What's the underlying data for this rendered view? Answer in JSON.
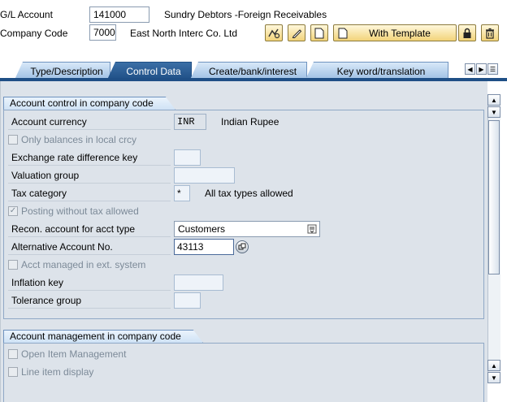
{
  "header": {
    "gl_account_label": "G/L Account",
    "gl_account_value": "141000",
    "gl_account_desc": "Sundry Debtors -Foreign Receivables",
    "company_code_label": "Company Code",
    "company_code_value": "7000",
    "company_name": "East North Interc Co. Ltd",
    "with_template_label": "With Template"
  },
  "toolbar_icons": [
    "change-display-icon",
    "edit-pencil-icon",
    "create-document-icon",
    "template-document-icon",
    "lock-icon",
    "trash-icon"
  ],
  "tabs": [
    {
      "label": "Type/Description",
      "active": false
    },
    {
      "label": "Control Data",
      "active": true
    },
    {
      "label": "Create/bank/interest",
      "active": false
    },
    {
      "label": "Key word/translation",
      "active": false
    }
  ],
  "account_control": {
    "title": "Account control in company code",
    "account_currency_label": "Account currency",
    "account_currency_value": "INR",
    "account_currency_desc": "Indian Rupee",
    "only_balances_label": "Only balances in local crcy",
    "only_balances_checked": false,
    "exchange_rate_label": "Exchange rate difference key",
    "exchange_rate_value": "",
    "valuation_group_label": "Valuation group",
    "valuation_group_value": "",
    "tax_category_label": "Tax category",
    "tax_category_value": "*",
    "tax_category_desc": "All tax types allowed",
    "posting_without_tax_label": "Posting without tax allowed",
    "posting_without_tax_checked": true,
    "recon_account_label": "Recon. account for acct type",
    "recon_account_value": "Customers",
    "alt_account_label": "Alternative Account No.",
    "alt_account_value": "43113",
    "acct_managed_ext_label": "Acct managed in ext. system",
    "acct_managed_ext_checked": false,
    "inflation_key_label": "Inflation key",
    "inflation_key_value": "",
    "tolerance_group_label": "Tolerance group",
    "tolerance_group_value": ""
  },
  "account_management": {
    "title": "Account management in company code",
    "open_item_label": "Open Item Management",
    "open_item_checked": false,
    "line_item_label": "Line item display",
    "line_item_checked": false
  },
  "colors": {
    "active_tab": "#1f4f86",
    "tab": "#9ec0e4",
    "panel_bg": "#dde3ea",
    "button_gold": "#f2d37a"
  }
}
